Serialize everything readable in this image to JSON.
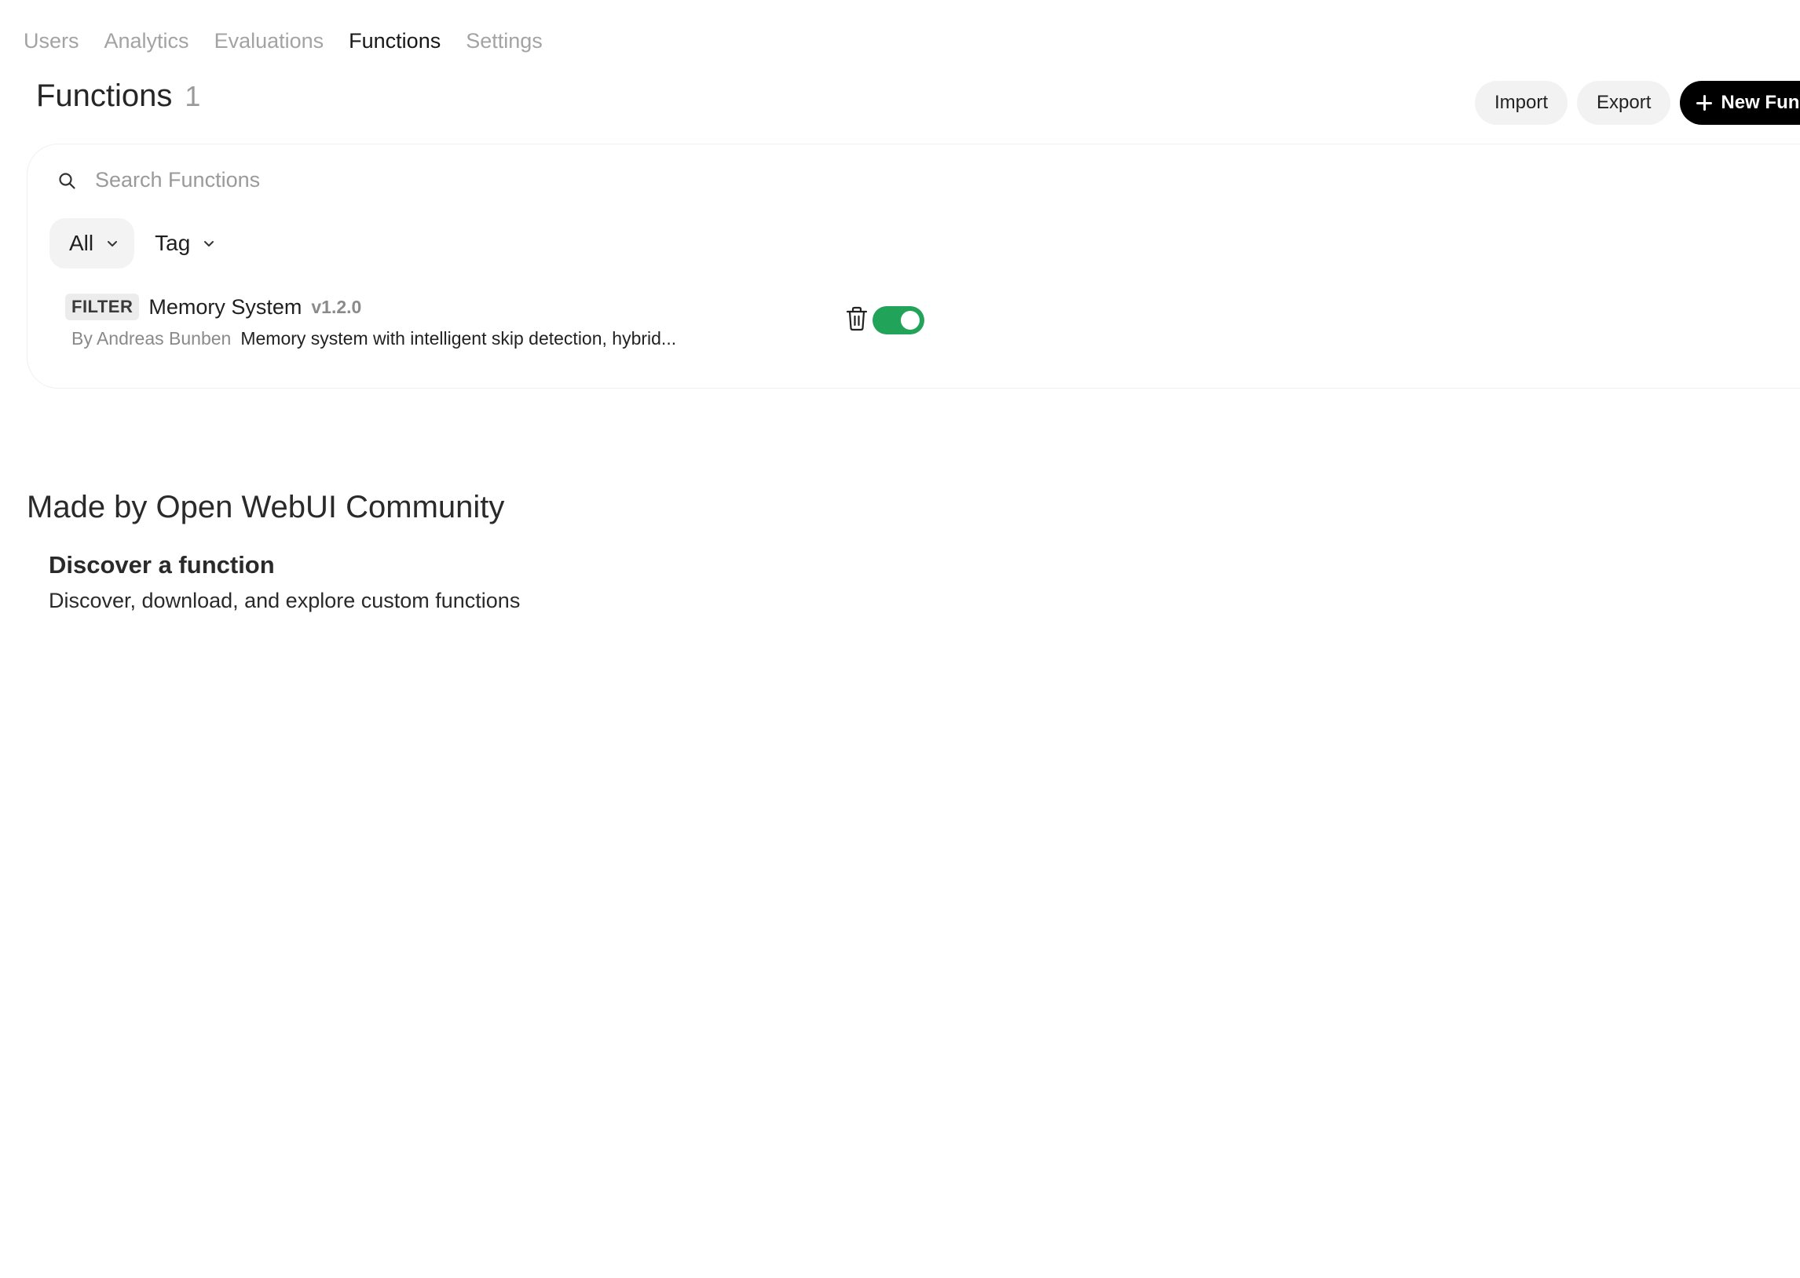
{
  "nav": {
    "tabs": [
      {
        "label": "Users",
        "active": false
      },
      {
        "label": "Analytics",
        "active": false
      },
      {
        "label": "Evaluations",
        "active": false
      },
      {
        "label": "Functions",
        "active": true
      },
      {
        "label": "Settings",
        "active": false
      }
    ]
  },
  "header": {
    "title": "Functions",
    "count": "1",
    "import_label": "Import",
    "export_label": "Export",
    "new_label": "New Function"
  },
  "search": {
    "placeholder": "Search Functions",
    "value": ""
  },
  "filters": {
    "type_selected": "All",
    "tag_label": "Tag"
  },
  "functions": [
    {
      "type": "FILTER",
      "name": "Memory System",
      "version": "v1.2.0",
      "author": "By Andreas Bunben",
      "description": "Memory system with intelligent skip detection, hybrid...",
      "enabled": true
    }
  ],
  "community": {
    "title": "Made by Open WebUI Community",
    "discover_title": "Discover a function",
    "discover_subtitle": "Discover, download, and explore custom functions"
  },
  "colors": {
    "toggle_on": "#22a35a",
    "primary_button": "#000000",
    "muted_text": "#a3a3a3"
  }
}
